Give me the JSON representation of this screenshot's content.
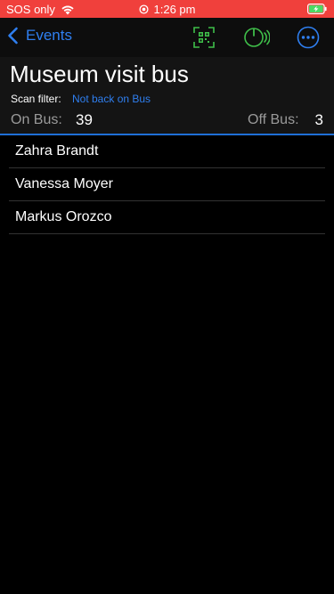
{
  "status_bar": {
    "carrier": "SOS only",
    "time": "1:26 pm",
    "background_color": "#f0403c"
  },
  "nav": {
    "back_label": "Events",
    "accent_color": "#2f7ff0",
    "icons": [
      "qr-code-scanner-icon",
      "rfid-scan-icon",
      "more-options-icon"
    ]
  },
  "header": {
    "title": "Museum visit bus",
    "scan_filter_label": "Scan filter:",
    "scan_filter_value": "Not back on Bus",
    "on_bus_label": "On Bus:",
    "on_bus_count": "39",
    "off_bus_label": "Off Bus:",
    "off_bus_count": "3"
  },
  "passengers": [
    {
      "name": "Zahra Brandt"
    },
    {
      "name": "Vanessa Moyer"
    },
    {
      "name": "Markus Orozco"
    }
  ]
}
